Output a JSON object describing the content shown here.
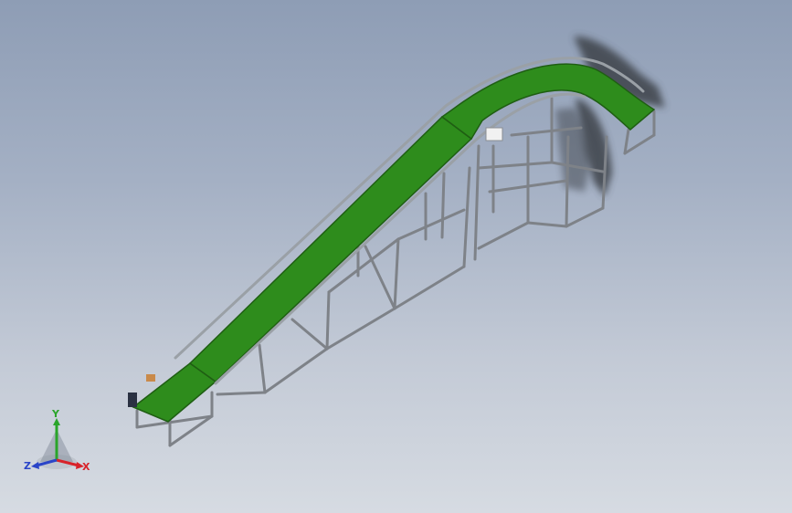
{
  "view": {
    "background_top": "#8e9db5",
    "background_bottom": "#d6dbe2"
  },
  "model": {
    "belt_color": "#2e8c1c",
    "frame_color": "#8a8e94",
    "shadow_color": "#3e4248"
  },
  "triad": {
    "x_label": "X",
    "y_label": "Y",
    "z_label": "Z",
    "x_color": "#d8232a",
    "y_color": "#2aa52a",
    "z_color": "#2a45c8"
  }
}
